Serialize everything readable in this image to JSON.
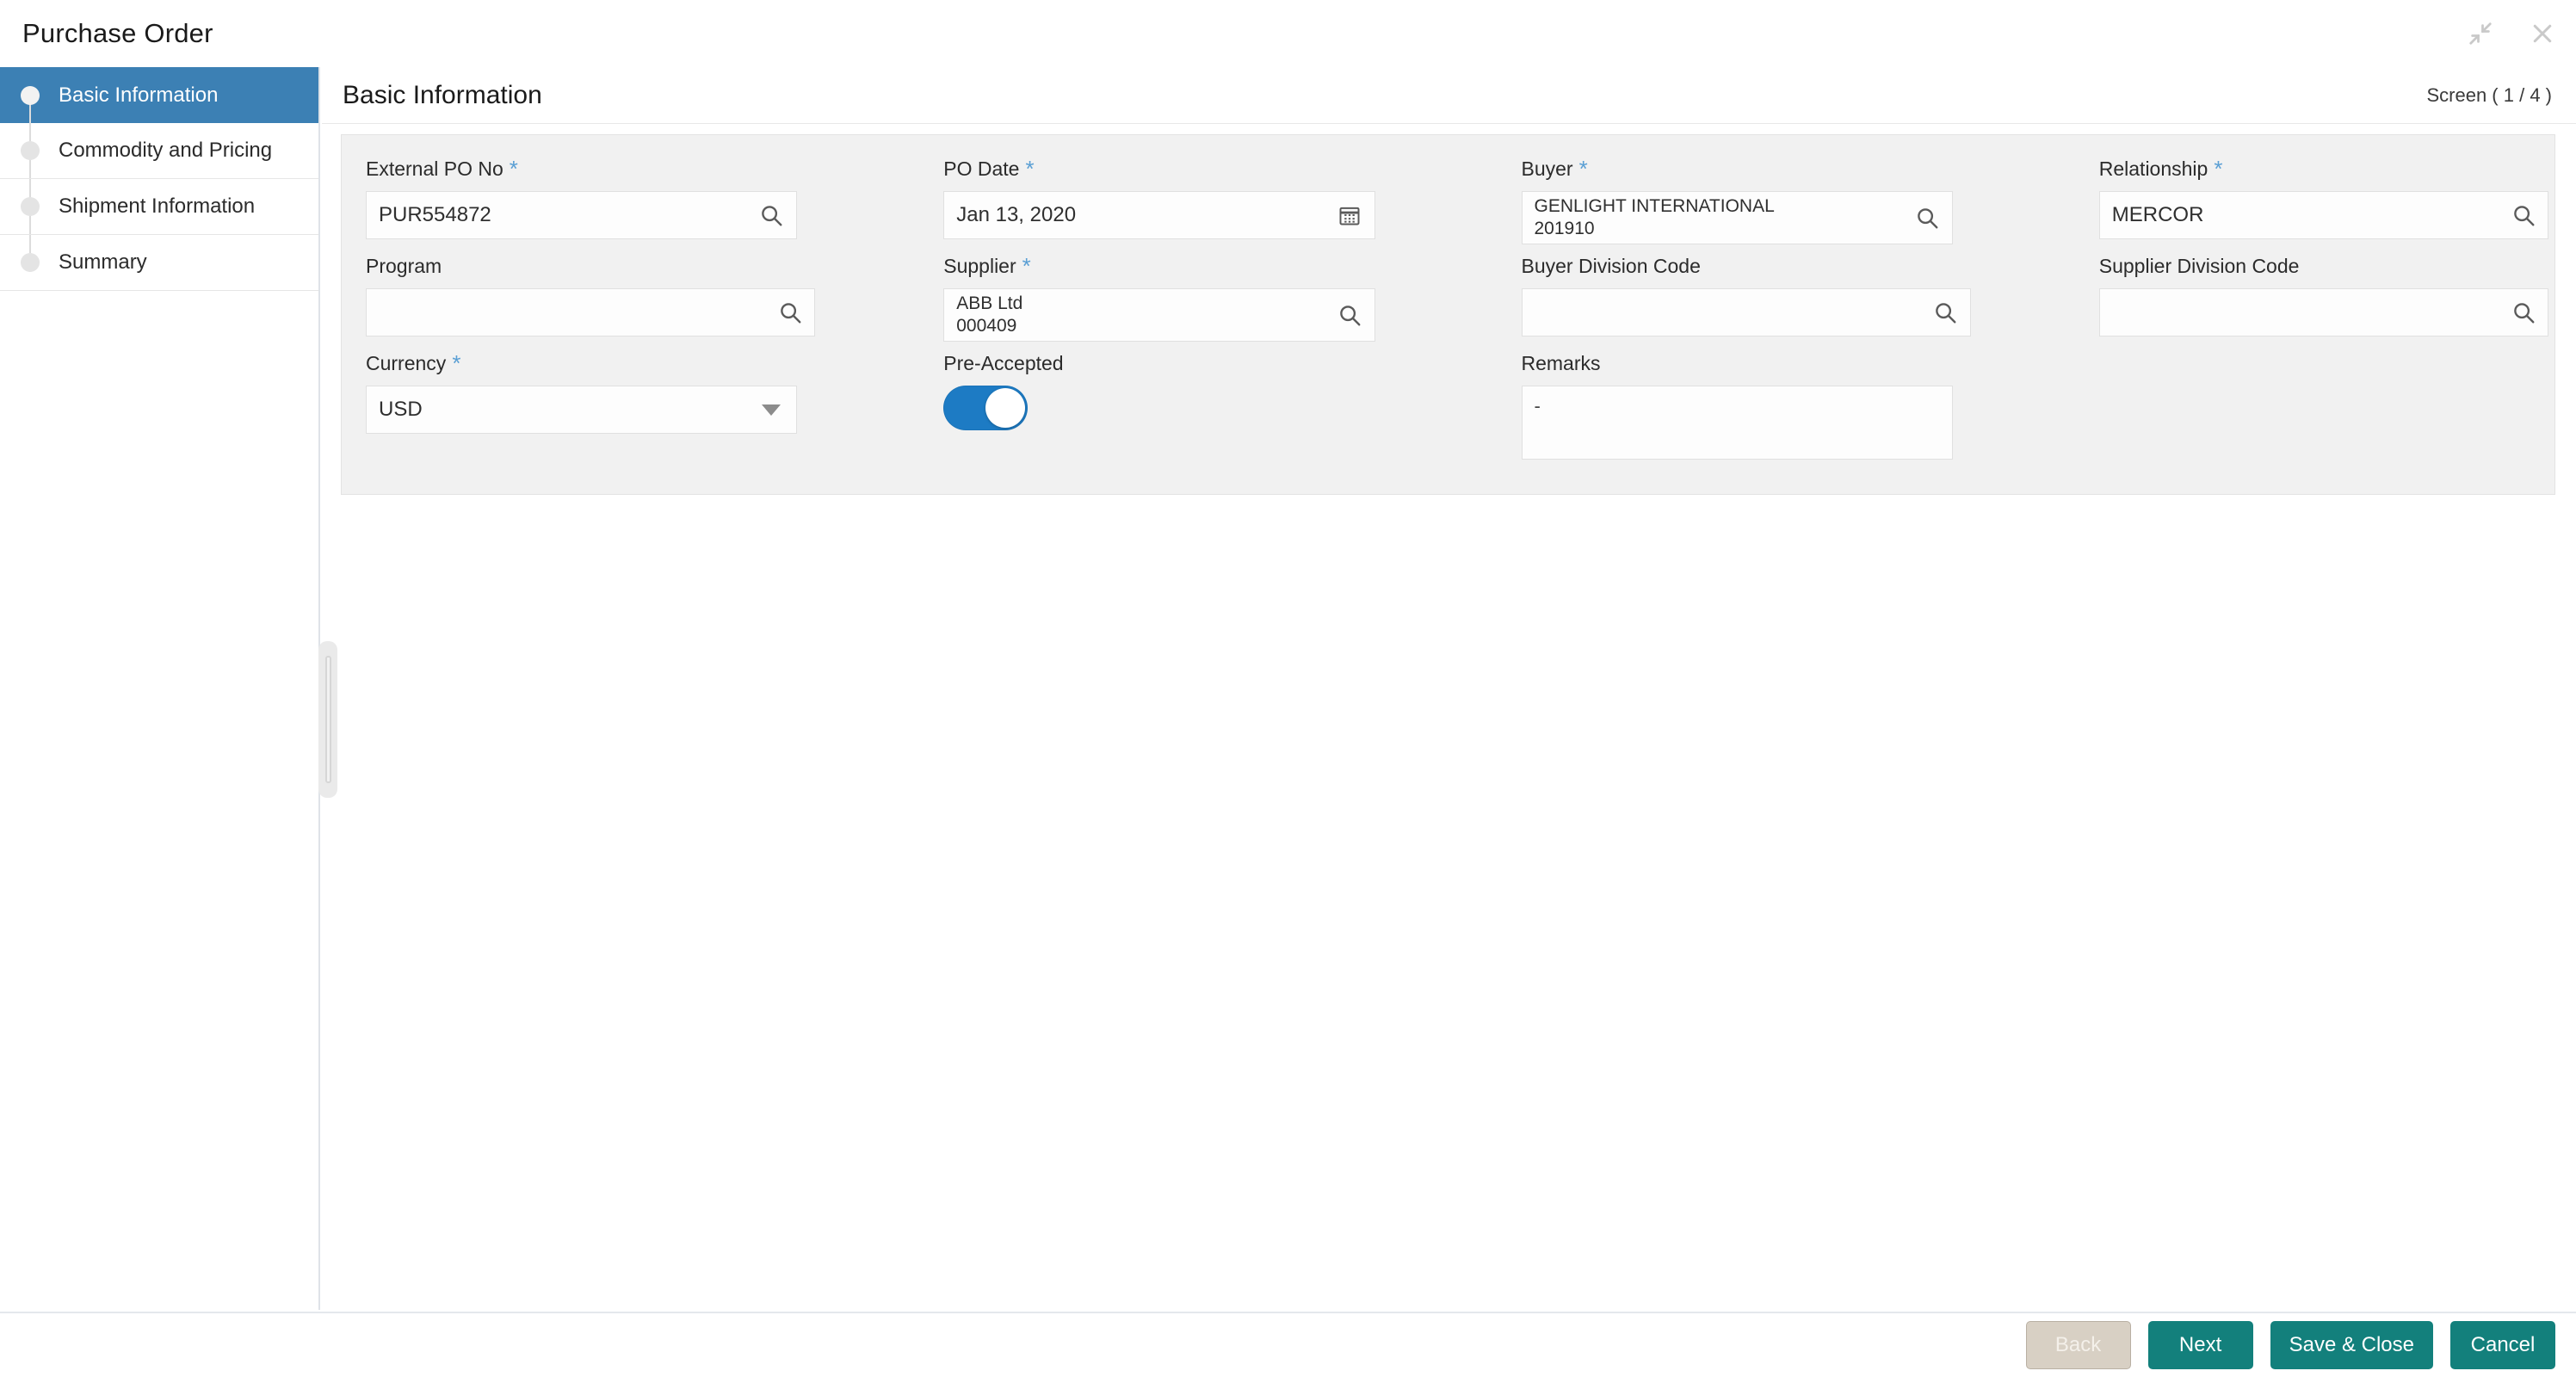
{
  "window": {
    "title": "Purchase Order",
    "controls": [
      {
        "name": "collapse-icon",
        "label": "Collapse"
      },
      {
        "name": "close-icon",
        "label": "Close"
      }
    ]
  },
  "sidebar": {
    "items": [
      {
        "label": "Basic Information",
        "active": true
      },
      {
        "label": "Commodity and Pricing",
        "active": false
      },
      {
        "label": "Shipment Information",
        "active": false
      },
      {
        "label": "Summary",
        "active": false
      }
    ]
  },
  "main": {
    "title": "Basic Information",
    "screen_indicator": "Screen ( 1 / 4 )"
  },
  "fields": {
    "external_po_no": {
      "label": "External PO No",
      "required": true,
      "value": "PUR554872",
      "placeholder": ""
    },
    "po_date": {
      "label": "PO Date",
      "required": true,
      "value": "Jan 13, 2020",
      "placeholder": ""
    },
    "buyer": {
      "label": "Buyer",
      "required": true,
      "line1": "GENLIGHT INTERNATIONAL",
      "line2": "201910"
    },
    "relationship": {
      "label": "Relationship",
      "required": true,
      "value": "MERCOR",
      "placeholder": ""
    },
    "program": {
      "label": "Program",
      "required": false,
      "value": "",
      "placeholder": ""
    },
    "supplier": {
      "label": "Supplier",
      "required": true,
      "line1": "ABB Ltd",
      "line2": "000409"
    },
    "buyer_division_code": {
      "label": "Buyer Division Code",
      "required": false,
      "value": "",
      "placeholder": ""
    },
    "supplier_division_code": {
      "label": "Supplier Division Code",
      "required": false,
      "value": "",
      "placeholder": ""
    },
    "currency": {
      "label": "Currency",
      "required": true,
      "value": "USD",
      "options": [
        "USD"
      ]
    },
    "pre_accepted": {
      "label": "Pre-Accepted",
      "checked": true
    },
    "remarks": {
      "label": "Remarks",
      "required": false,
      "value": "-"
    }
  },
  "footer": {
    "back_label": "Back",
    "next_label": "Next",
    "save_close_label": "Save & Close",
    "cancel_label": "Cancel"
  },
  "colors": {
    "sidebar_active": "#3c80b4",
    "button_primary": "#13807c",
    "button_disabled": "#d8d0c4",
    "required_asterisk": "#5a9fd4",
    "toggle_on": "#1d7bc4",
    "panel_background": "#f1f1f1"
  }
}
